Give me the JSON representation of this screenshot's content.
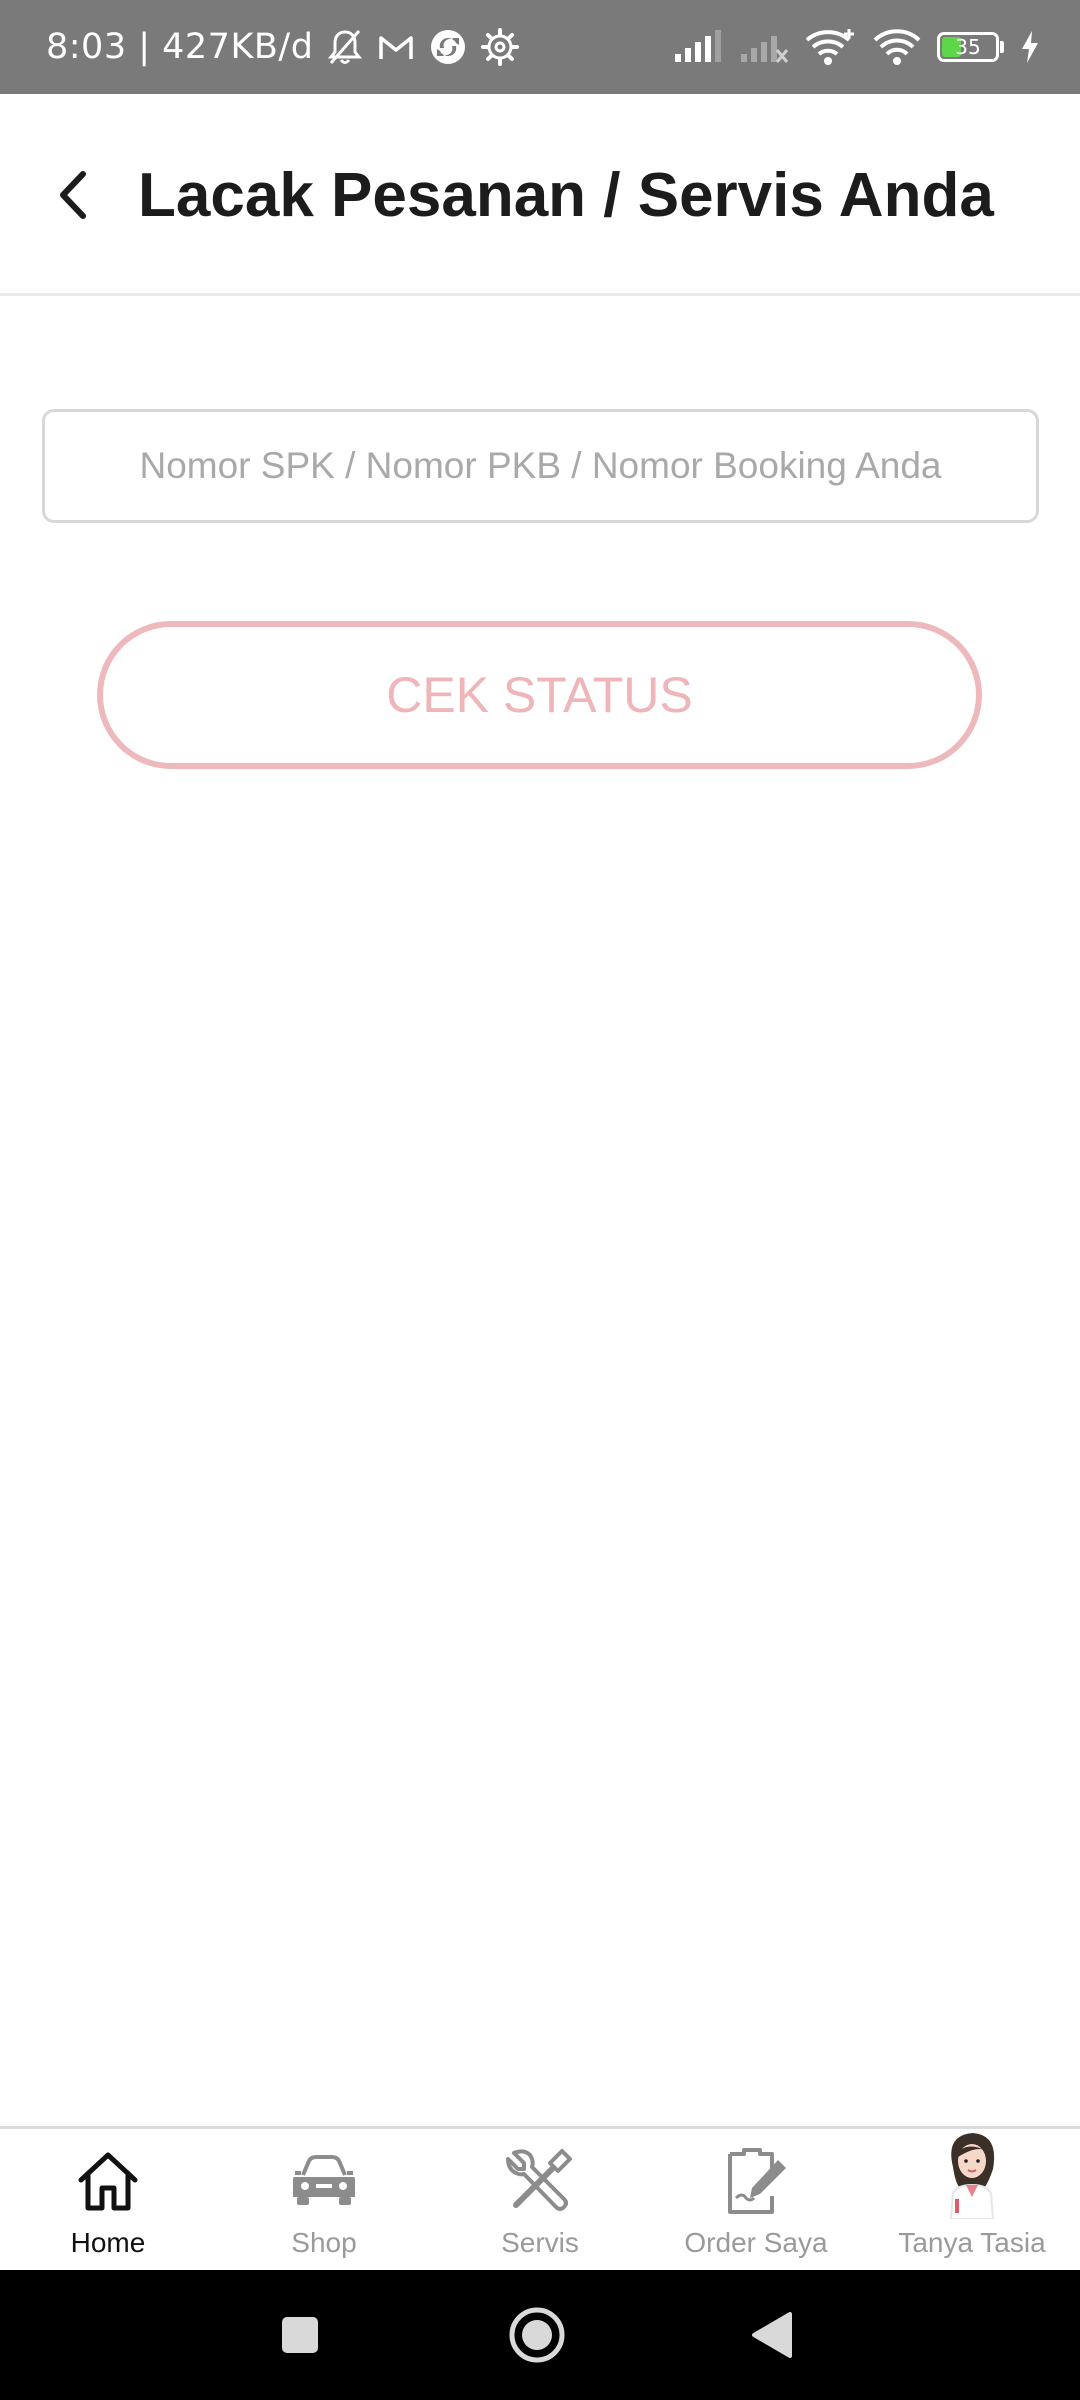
{
  "status_bar": {
    "time": "8:03 | 427KB/d",
    "battery_level": "35",
    "icons": [
      "mute-bell-icon",
      "gmail-icon",
      "sync-icon",
      "settings-icon",
      "signal-icon",
      "signal-no-sim-icon",
      "wifi-plus-icon",
      "wifi-icon",
      "battery-icon",
      "charging-icon"
    ]
  },
  "header": {
    "back_icon": "chevron-left-icon",
    "title": "Lacak Pesanan / Servis Anda"
  },
  "form": {
    "input_placeholder": "Nomor SPK / Nomor PKB / Nomor Booking Anda",
    "input_value": "",
    "button_label": "CEK STATUS"
  },
  "colors": {
    "button_border": "#eeb9bd",
    "button_text": "#efb5b9",
    "status_bar_bg": "#7a7a7a",
    "active_nav": "#111111",
    "inactive_nav": "#9a9a9a"
  },
  "bottom_nav": {
    "items": [
      {
        "label": "Home",
        "icon": "home-icon",
        "active": true
      },
      {
        "label": "Shop",
        "icon": "car-icon",
        "active": false
      },
      {
        "label": "Servis",
        "icon": "tools-icon",
        "active": false
      },
      {
        "label": "Order Saya",
        "icon": "clipboard-edit-icon",
        "active": false
      },
      {
        "label": "Tanya Tasia",
        "icon": "assistant-avatar-icon",
        "active": false
      }
    ]
  },
  "system_nav": [
    "recents-square-icon",
    "home-circle-icon",
    "back-triangle-icon"
  ]
}
